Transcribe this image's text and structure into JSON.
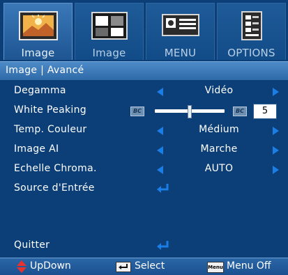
{
  "tabs": [
    {
      "label": "Image",
      "icon": "image-landscape-icon",
      "active": true
    },
    {
      "label": "Image",
      "icon": "image-pattern-icon",
      "active": false
    },
    {
      "label": "MENU",
      "icon": "projector-icon",
      "active": false
    },
    {
      "label": "OPTIONS",
      "icon": "options-icon",
      "active": false
    }
  ],
  "section_title": "Image | Avancé",
  "rows": {
    "degamma": {
      "label": "Degamma",
      "value": "Vidéo"
    },
    "white_peaking": {
      "label": "White Peaking",
      "value": "5",
      "level": 0.5
    },
    "temp_couleur": {
      "label": "Temp. Couleur",
      "value": "Médium"
    },
    "image_ai": {
      "label": "Image AI",
      "value": "Marche"
    },
    "echelle_chroma": {
      "label": "Echelle Chroma.",
      "value": "AUTO"
    },
    "source_entree": {
      "label": "Source d'Entrée"
    },
    "quitter": {
      "label": "Quitter"
    }
  },
  "footer": {
    "updown": "UpDown",
    "select": "Select",
    "menu_badge": "Menu",
    "menu_off": "Menu Off"
  },
  "colors": {
    "background": "#0c3f78",
    "arrow": "#1b7ee6",
    "header": "#3d7bb9"
  }
}
